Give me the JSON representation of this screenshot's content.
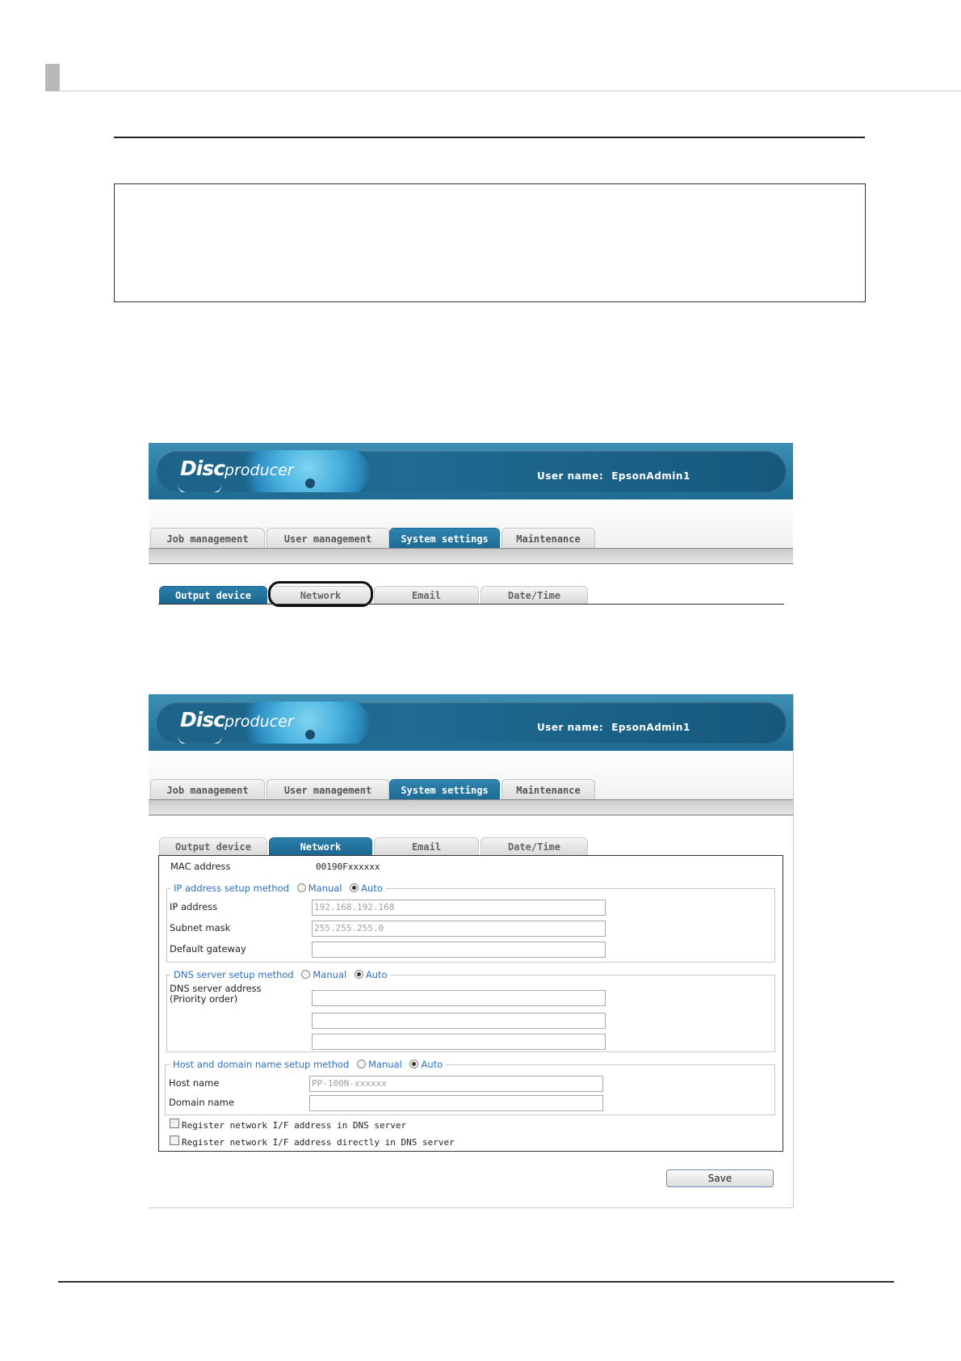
{
  "app": {
    "logo_disc": "Disc",
    "logo_producer": "producer",
    "user_label": "User name:",
    "user_name": "EpsonAdmin1"
  },
  "main_tabs": [
    {
      "label": "Job management"
    },
    {
      "label": "User management"
    },
    {
      "label": "System settings",
      "active": true
    },
    {
      "label": "Maintenance"
    }
  ],
  "sub_tabs": [
    {
      "label": "Output device"
    },
    {
      "label": "Network"
    },
    {
      "label": "Email"
    },
    {
      "label": "Date/Time"
    }
  ],
  "shot1_active_subtab": "Output device",
  "shot2_active_subtab": "Network",
  "network": {
    "mac_label": "MAC address",
    "mac_value": "00190Fxxxxxx",
    "ip_group": {
      "legend": "IP address setup method",
      "manual": "Manual",
      "auto": "Auto",
      "selected": "Auto",
      "ip_label": "IP address",
      "ip_value": "192.168.192.168",
      "subnet_label": "Subnet mask",
      "subnet_value": "255.255.255.0",
      "gateway_label": "Default gateway",
      "gateway_value": ""
    },
    "dns_group": {
      "legend": "DNS server setup method",
      "manual": "Manual",
      "auto": "Auto",
      "selected": "Auto",
      "dns_label_1": "DNS server address",
      "dns_label_2": "(Priority order)",
      "dns_values": [
        "",
        "",
        ""
      ]
    },
    "host_group": {
      "legend": "Host and domain name setup method",
      "manual": "Manual",
      "auto": "Auto",
      "selected": "Auto",
      "host_label": "Host name",
      "host_value": "PP-100N-xxxxxx",
      "domain_label": "Domain name",
      "domain_value": ""
    },
    "check_register": "Register network I/F address in DNS server",
    "check_register_direct": "Register network I/F address directly in DNS server",
    "save_label": "Save"
  },
  "colors": {
    "banner": "#1f6b91",
    "active_tab": "#1d6a94",
    "legend_text": "#2d6fc4"
  }
}
